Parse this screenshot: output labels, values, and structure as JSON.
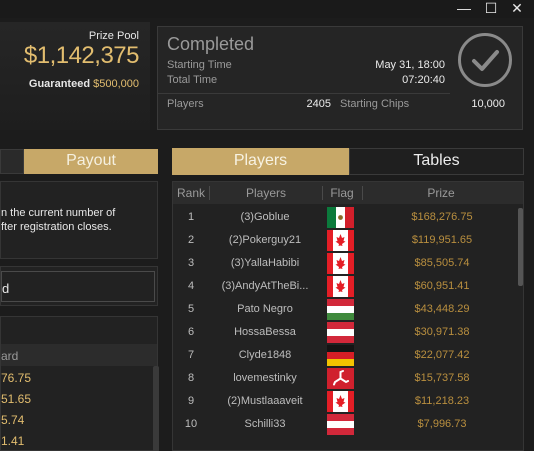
{
  "window": {
    "minimize": "—",
    "maximize": "☐",
    "close": "✕"
  },
  "prize": {
    "label": "Prize Pool",
    "amount": "$1,142,375",
    "guaranteed_label": "Guaranteed",
    "guaranteed_value": "$500,000"
  },
  "status": {
    "title": "Completed",
    "starting_time_label": "Starting Time",
    "starting_time_value": "May 31, 18:00",
    "total_time_label": "Total Time",
    "total_time_value": "07:20:40",
    "players_label": "Players",
    "players_value": "2405",
    "starting_chips_label": "Starting Chips",
    "starting_chips_value": "10,000",
    "icon": "checkmark-circle-icon"
  },
  "left": {
    "payout_tab": "Payout",
    "info_line1": "n the current number of",
    "info_line2": "fter registration closes.",
    "select_text": "d",
    "table_header": "ard",
    "values": [
      "76.75",
      "51.65",
      "5.74",
      "1.41"
    ]
  },
  "tabs": {
    "players": "Players",
    "tables": "Tables"
  },
  "players_table": {
    "headers": {
      "rank": "Rank",
      "players": "Players",
      "flag": "Flag",
      "prize": "Prize"
    },
    "rows": [
      {
        "rank": "1",
        "name": "(3)Goblue",
        "flag": "mexico",
        "prize": "$168,276.75"
      },
      {
        "rank": "2",
        "name": "(2)Pokerguy21",
        "flag": "canada",
        "prize": "$119,951.65"
      },
      {
        "rank": "3",
        "name": "(3)YallaHabibi",
        "flag": "canada",
        "prize": "$85,505.74"
      },
      {
        "rank": "4",
        "name": "(3)AndyAtTheBi...",
        "flag": "canada",
        "prize": "$60,951.41"
      },
      {
        "rank": "5",
        "name": "Pato Negro",
        "flag": "hungary",
        "prize": "$43,448.29"
      },
      {
        "rank": "6",
        "name": "HossaBessa",
        "flag": "austria",
        "prize": "$30,971.38"
      },
      {
        "rank": "7",
        "name": "Clyde1848",
        "flag": "germany",
        "prize": "$22,077.42"
      },
      {
        "rank": "8",
        "name": "lovemestinky",
        "flag": "isle-of-man",
        "prize": "$15,737.58"
      },
      {
        "rank": "9",
        "name": "(2)Mustlaaaveit",
        "flag": "canada",
        "prize": "$11,218.23"
      },
      {
        "rank": "10",
        "name": "Schilli33",
        "flag": "austria",
        "prize": "$7,996.73"
      }
    ]
  }
}
